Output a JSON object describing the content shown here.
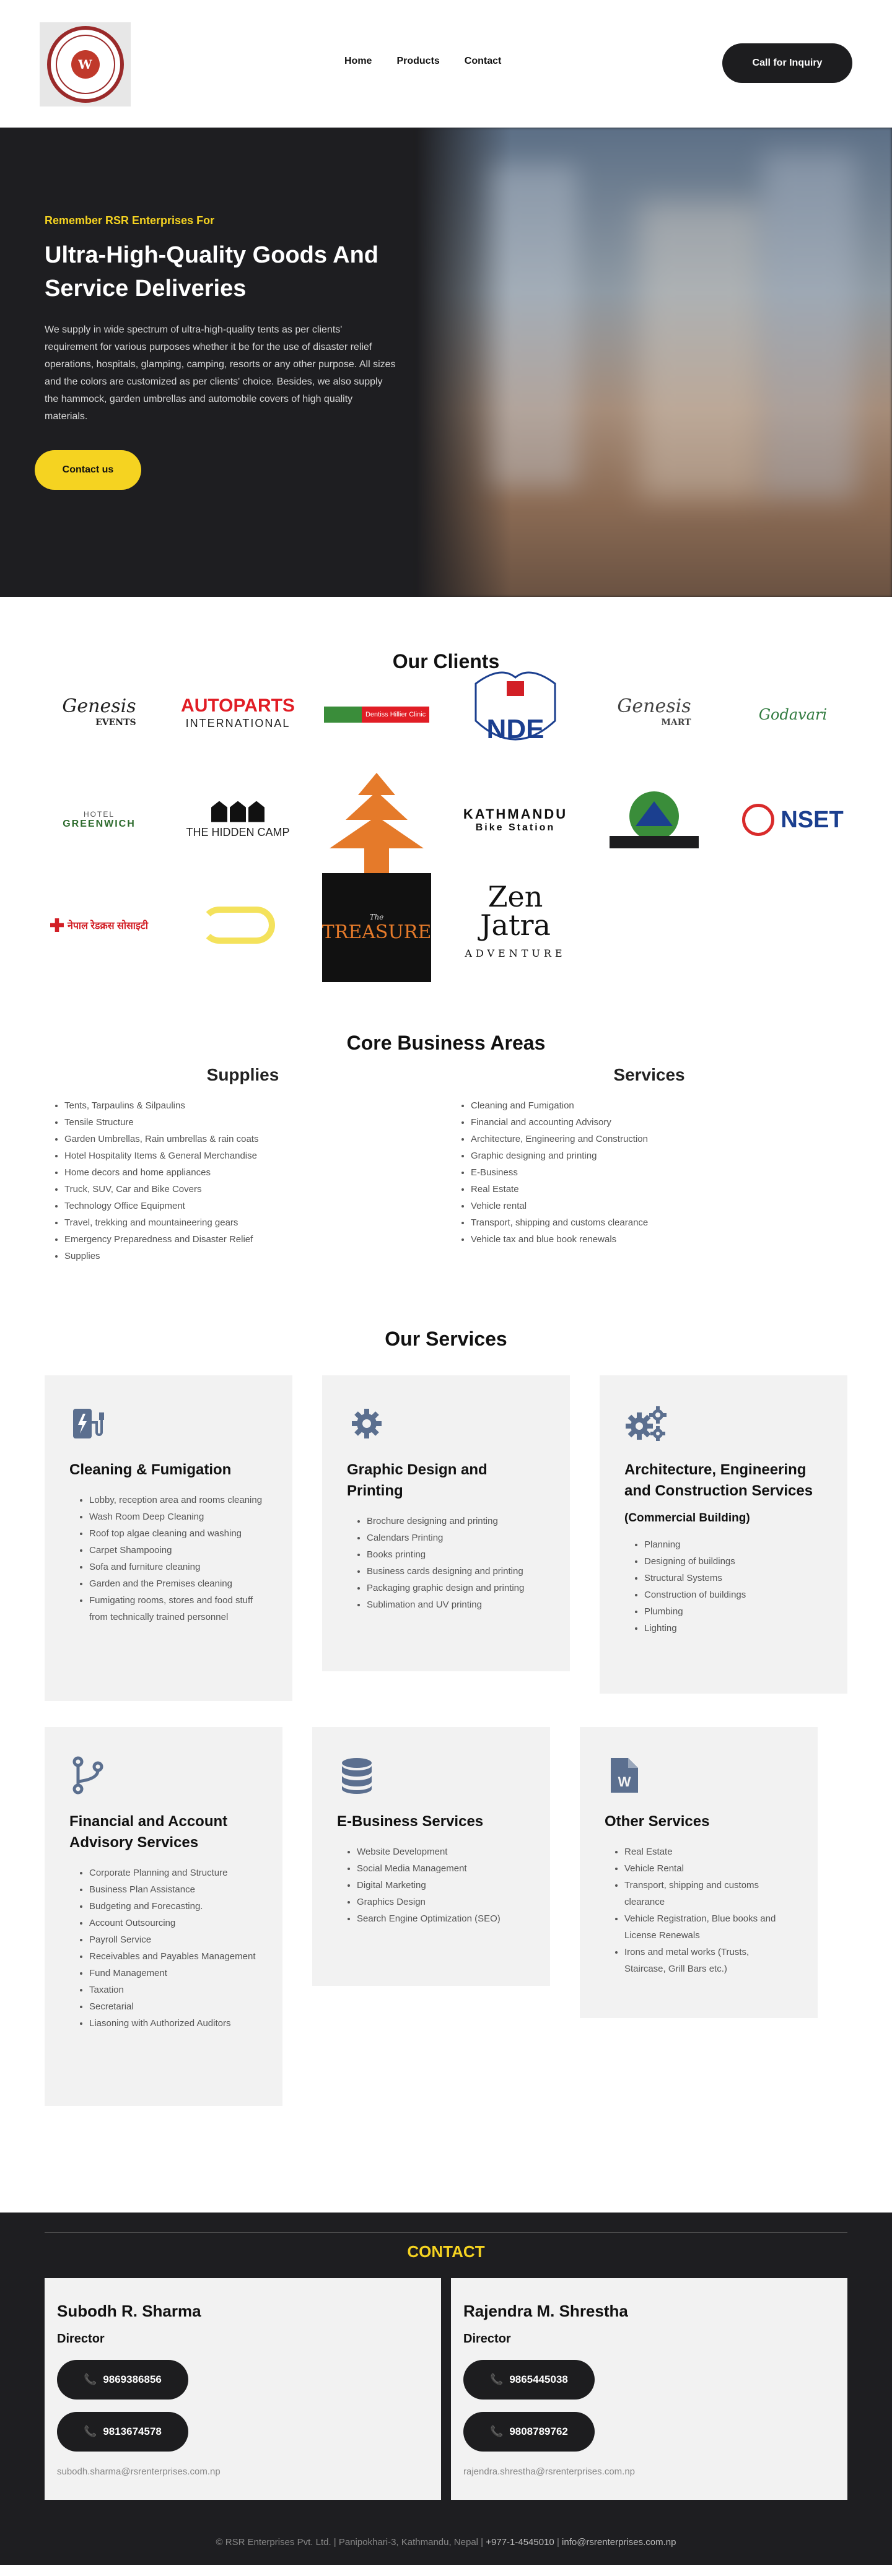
{
  "header": {
    "logo_text": "R.S.R ENTERPRISES",
    "logo_mark": "W",
    "nav": [
      "Home",
      "Products",
      "Contact"
    ],
    "cta": "Call for Inquiry"
  },
  "hero": {
    "eyebrow": "Remember RSR Enterprises For",
    "title": "Ultra-High-Quality Goods And Service Deliveries",
    "description": "We supply in wide spectrum of ultra-high-quality tents as per clients' requirement for various purposes whether it be for the use of disaster relief operations, hospitals, glamping, camping, resorts or any other purpose. All sizes and the colors are customized as per clients' choice. Besides, we also supply the hammock, garden umbrellas and automobile covers of high quality materials.",
    "cta": "Contact us"
  },
  "clients": {
    "title": "Our Clients",
    "logos": {
      "genesis_events": [
        "Genesis",
        "EVENTS"
      ],
      "autoparts": [
        "AUTOPARTS",
        "INTERNATIONAL"
      ],
      "dhm": [
        "",
        "Dentiss Hillier Clinic"
      ],
      "nde": "NDE",
      "genesis_mart": [
        "Genesis",
        "MART"
      ],
      "godavari": "Godavari",
      "greenwich": [
        "HOTEL",
        "GREENWICH"
      ],
      "hidden_camp": "THE HIDDEN CAMP",
      "ktm_bike": [
        "KATHMANDU",
        "Bike Station"
      ],
      "nset": "NSET",
      "red_cross": "नेपाल रेडक्रस सोसाइटी",
      "treasure": [
        "The",
        "TREASURE"
      ],
      "zen_jatra": [
        "Zen Jatra",
        "ADVENTURE"
      ]
    }
  },
  "core": {
    "title": "Core Business Areas",
    "supplies_title": "Supplies",
    "supplies": [
      "Tents, Tarpaulins & Silpaulins",
      "Tensile Structure",
      "Garden Umbrellas, Rain umbrellas & rain coats",
      "Hotel Hospitality Items & General Merchandise",
      "Home decors and home appliances",
      "Truck, SUV, Car and Bike Covers",
      "Technology Office Equipment",
      "Travel, trekking and mountaineering gears",
      "Emergency Preparedness and Disaster Relief",
      "Supplies"
    ],
    "services_title": "Services",
    "services": [
      "Cleaning and Fumigation",
      "Financial and accounting Advisory",
      "Architecture, Engineering and Construction",
      "Graphic designing and printing",
      "E-Business",
      "Real Estate",
      "Vehicle rental",
      "Transport, shipping and customs clearance",
      "Vehicle tax and blue book renewals"
    ]
  },
  "services": {
    "title": "Our Services",
    "cards": [
      {
        "icon": "ev-charger-icon",
        "title": "Cleaning & Fumigation",
        "subtitle": "",
        "items": [
          "Lobby, reception area and rooms cleaning",
          "Wash Room Deep Cleaning",
          "Roof top algae cleaning and washing",
          "Carpet Shampooing",
          "Sofa and furniture cleaning",
          "Garden and the Premises cleaning",
          "Fumigating rooms, stores and food stuff from technically trained personnel"
        ]
      },
      {
        "icon": "gear-icon",
        "title": "Graphic Design and Printing",
        "subtitle": "",
        "items": [
          "Brochure designing and printing",
          "Calendars Printing",
          "Books printing",
          "Business cards designing and printing",
          "Packaging graphic design and printing",
          "Sublimation and UV printing"
        ]
      },
      {
        "icon": "gears-icon",
        "title": "Architecture, Engineering and Construction Services",
        "subtitle": "(Commercial Building)",
        "items": [
          "Planning",
          "Designing of buildings",
          "Structural Systems",
          "Construction of buildings",
          "Plumbing",
          "Lighting"
        ]
      },
      {
        "icon": "code-branch-icon",
        "title": "Financial and Account Advisory Services",
        "subtitle": "",
        "items": [
          "Corporate Planning and Structure",
          "Business Plan Assistance",
          "Budgeting and Forecasting.",
          "Account Outsourcing",
          "Payroll Service",
          "Receivables and Payables Management",
          "Fund Management",
          "Taxation",
          "Secretarial",
          "Liasoning with Authorized Auditors"
        ]
      },
      {
        "icon": "database-icon",
        "title": "E-Business Services",
        "subtitle": "",
        "items": [
          "Website Development",
          "Social Media Management",
          "Digital Marketing",
          "Graphics Design",
          "Search Engine Optimization (SEO)"
        ]
      },
      {
        "icon": "word-file-icon",
        "title": "Other Services",
        "subtitle": "",
        "items": [
          "Real Estate",
          "Vehicle Rental",
          "Transport, shipping and customs clearance",
          "Vehicle Registration, Blue books and License Renewals",
          "Irons and metal works (Trusts, Staircase, Grill Bars etc.)"
        ]
      }
    ]
  },
  "contact": {
    "title": "CONTACT",
    "people": [
      {
        "name": "Subodh R. Sharma",
        "role": "Director",
        "phones": [
          "9869386856",
          "9813674578"
        ],
        "email": "subodh.sharma@rsrenterprises.com.np"
      },
      {
        "name": "Rajendra M. Shrestha",
        "role": "Director",
        "phones": [
          "9865445038",
          "9808789762"
        ],
        "email": "rajendra.shrestha@rsrenterprises.com.np"
      }
    ],
    "footer_left": "© RSR Enterprises Pvt. Ltd. | Panipokhari-3, Kathmandu, Nepal |",
    "footer_phone": "+977-1-4545010",
    "footer_sep": "|",
    "footer_email": "info@rsrenterprises.com.np"
  },
  "colors": {
    "accent": "#f5d321",
    "dark": "#1e1e21",
    "card": "#f2f2f2",
    "autoparts_red": "#e11d25",
    "nset_blue": "#1b3f8f"
  }
}
